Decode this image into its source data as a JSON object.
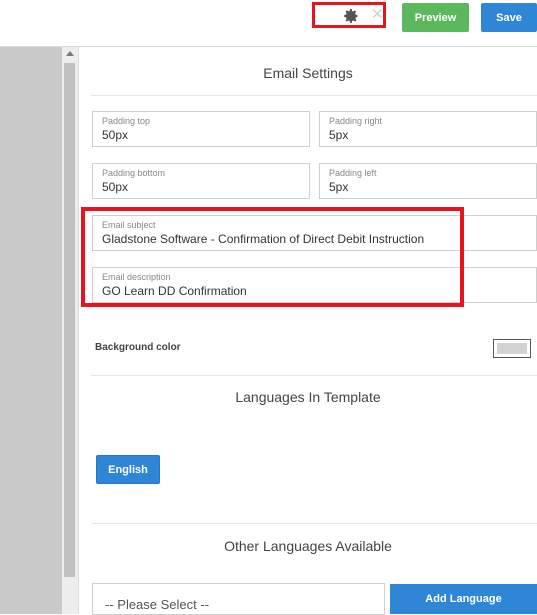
{
  "toolbar": {
    "settings_icon": "gear-icon",
    "close_icon": "close-icon",
    "close_glyph": "✕",
    "preview_label": "Preview",
    "save_label": "Save"
  },
  "email_settings": {
    "title": "Email Settings",
    "padding_top": {
      "label": "Padding top",
      "value": "50px"
    },
    "padding_right": {
      "label": "Padding right",
      "value": "5px"
    },
    "padding_bottom": {
      "label": "Padding bottom",
      "value": "50px"
    },
    "padding_left": {
      "label": "Padding left",
      "value": "5px"
    },
    "email_subject": {
      "label": "Email subject",
      "value": "Gladstone Software - Confirmation of Direct Debit Instruction"
    },
    "email_description": {
      "label": "Email description",
      "value": "GO Learn DD Confirmation"
    },
    "background_color": {
      "label": "Background color",
      "value": "#d3d3d3"
    }
  },
  "languages_in_template": {
    "title": "Languages In Template",
    "items": [
      {
        "label": "English"
      }
    ]
  },
  "other_languages": {
    "title": "Other Languages Available",
    "select_value": "-- Please Select --",
    "add_label": "Add Language"
  },
  "colors": {
    "highlight": "#e8131c",
    "preview": "#5cb85c",
    "primary": "#2f86d6"
  }
}
